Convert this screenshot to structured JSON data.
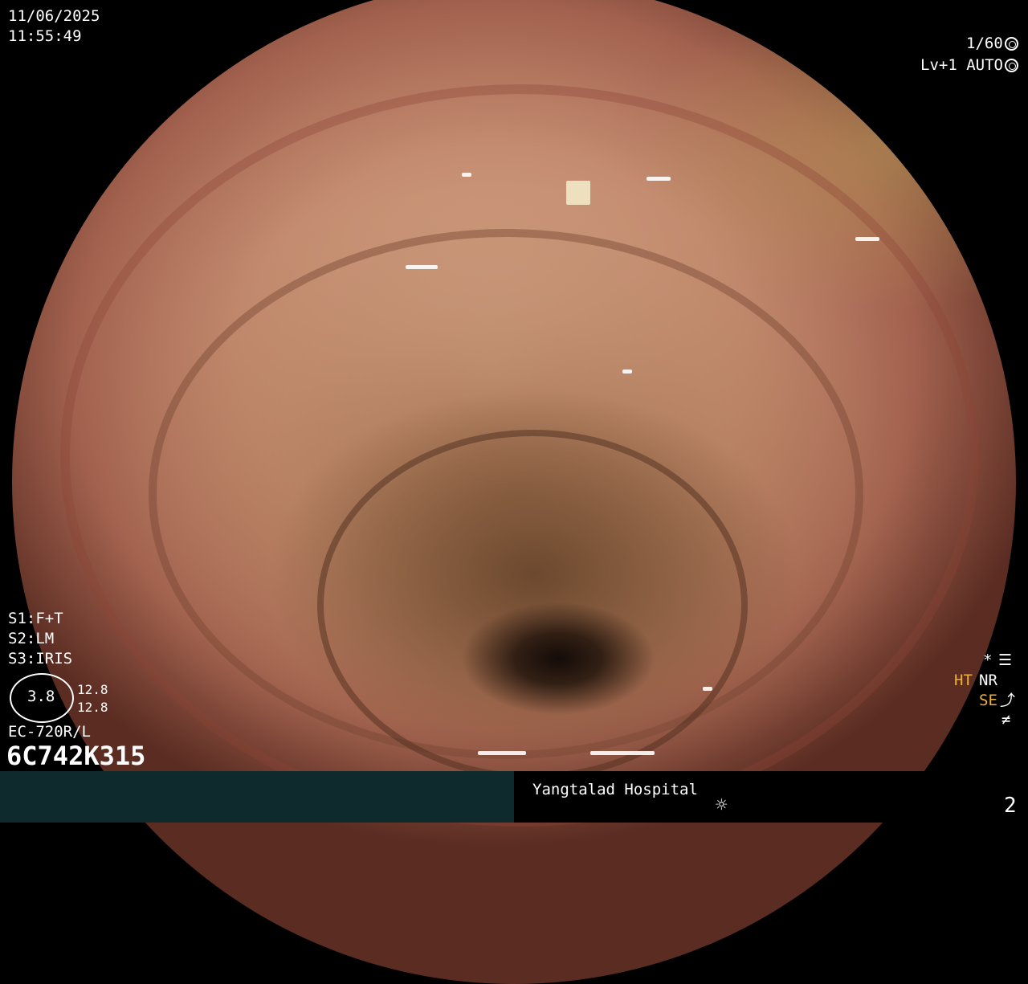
{
  "overlay": {
    "date": "11/06/2025",
    "time": "11:55:49",
    "shutter": "1/60",
    "level": "Lv+1",
    "iris_mode": "AUTO",
    "s1": "S1:F+T",
    "s2": "S2:LM",
    "s3": "S3:IRIS",
    "gauge_value": "3.8",
    "gauge_upper": "12.8",
    "gauge_lower": "12.8",
    "scope_model": "EC-720R/L",
    "scope_serial": "6C742K315",
    "asterisk": "*",
    "ht_label": "HT",
    "nr_label": "NR",
    "se_label": "SE",
    "neq_symbol": "≠"
  },
  "footer": {
    "hospital": "Yangtalad Hospital",
    "page_number": "2",
    "light_icon": "sun-icon"
  }
}
